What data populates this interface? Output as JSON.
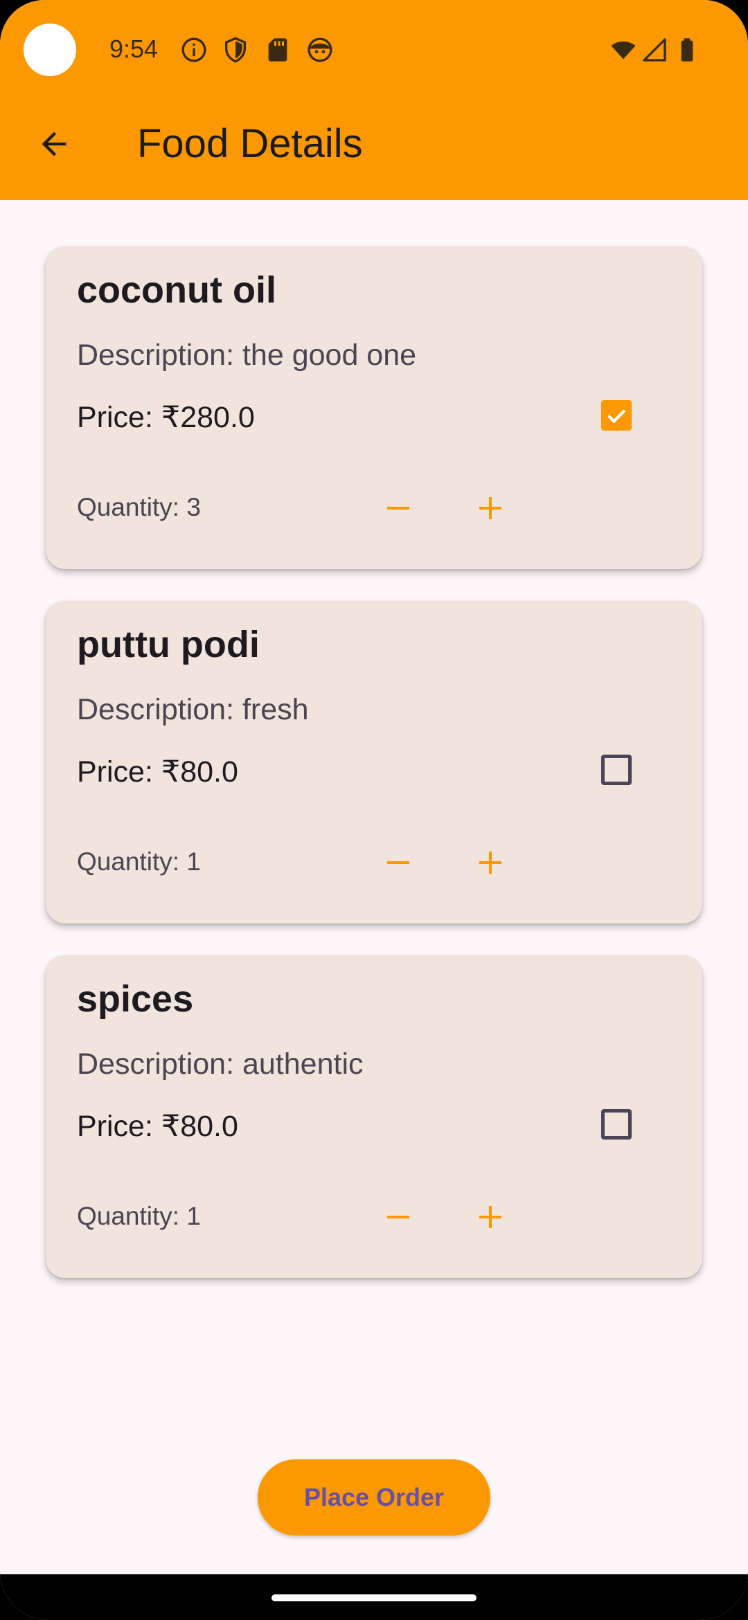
{
  "status_bar": {
    "time": "9:54"
  },
  "app_bar": {
    "title": "Food Details"
  },
  "items": [
    {
      "name": "coconut oil",
      "description": "Description: the good one",
      "price": "Price: ₹280.0",
      "quantity": "Quantity: 3",
      "selected": true
    },
    {
      "name": "puttu podi",
      "description": "Description: fresh",
      "price": "Price: ₹80.0",
      "quantity": "Quantity: 1",
      "selected": false
    },
    {
      "name": "spices",
      "description": "Description: authentic",
      "price": "Price: ₹80.0",
      "quantity": "Quantity: 1",
      "selected": false
    }
  ],
  "place_order_label": "Place Order",
  "colors": {
    "accent": "#fb9802",
    "card_background": "#f0e4dc",
    "button_text": "#6750a4"
  },
  "icons": [
    "back-arrow-icon",
    "info-icon",
    "shield-icon",
    "sd-card-icon",
    "face-icon",
    "wifi-icon",
    "signal-icon",
    "battery-icon",
    "minus-icon",
    "plus-icon",
    "check-icon"
  ]
}
